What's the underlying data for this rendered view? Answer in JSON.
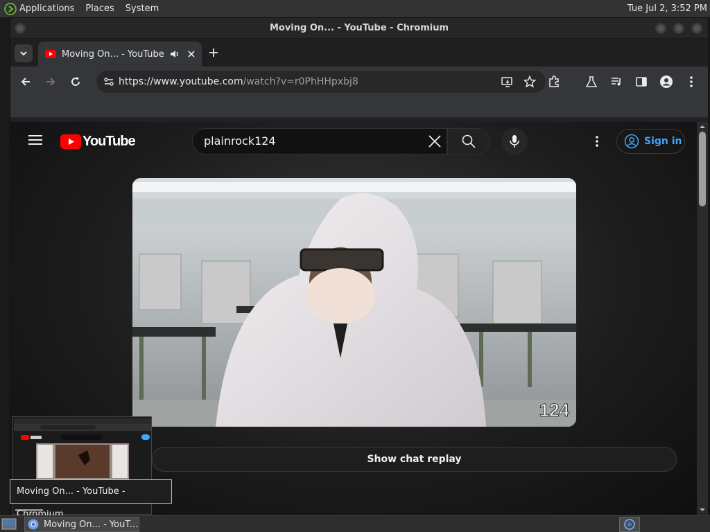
{
  "panel": {
    "applications": "Applications",
    "places": "Places",
    "system": "System",
    "clock": "Tue Jul  2,  3:52 PM"
  },
  "window": {
    "title": "Moving On... - YouTube - Chromium"
  },
  "browser": {
    "tab_title": "Moving On... - YouTube",
    "url_host": "https://www.youtube.com",
    "url_path": "/watch?v=r0PhHHpxbj8"
  },
  "youtube": {
    "logo_text": "YouTube",
    "search_value": "plainrock124",
    "signin_label": "Sign in",
    "video_watermark": "124",
    "chat_replay_label": "Show chat replay"
  },
  "tooltip": {
    "text": "Moving On... - YouTube - Chromium"
  },
  "taskbar": {
    "item_label": "Moving On... - YouT..."
  },
  "colors": {
    "youtube_red": "#ff0000",
    "link_blue": "#3ea6ff"
  }
}
